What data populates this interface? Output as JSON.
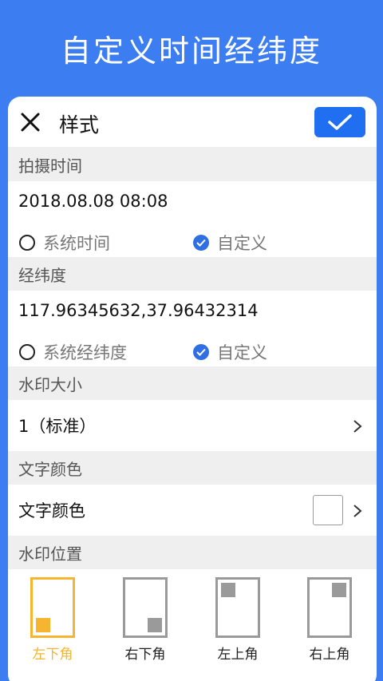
{
  "banner": {
    "title": "自定义时间经纬度"
  },
  "toolbar": {
    "title": "样式"
  },
  "capture_time": {
    "header": "拍摄时间",
    "value": "2018.08.08 08:08",
    "option_system": "系统时间",
    "option_custom": "自定义",
    "selected": "custom"
  },
  "coordinates": {
    "header": "经纬度",
    "value": "117.96345632,37.96432314",
    "option_system": "系统经纬度",
    "option_custom": "自定义",
    "selected": "custom"
  },
  "watermark_size": {
    "header": "水印大小",
    "value": "1（标准）"
  },
  "text_color": {
    "header": "文字颜色",
    "label": "文字颜色",
    "swatch_color": "#ffffff"
  },
  "watermark_position": {
    "header": "水印位置",
    "options": [
      "左下角",
      "右下角",
      "左上角",
      "右上角"
    ],
    "selected": "左下角"
  },
  "colors": {
    "background": "#3c7ef2",
    "primary": "#1f6ff0",
    "accent": "#f6b530",
    "inactive": "#9a9a9a"
  }
}
